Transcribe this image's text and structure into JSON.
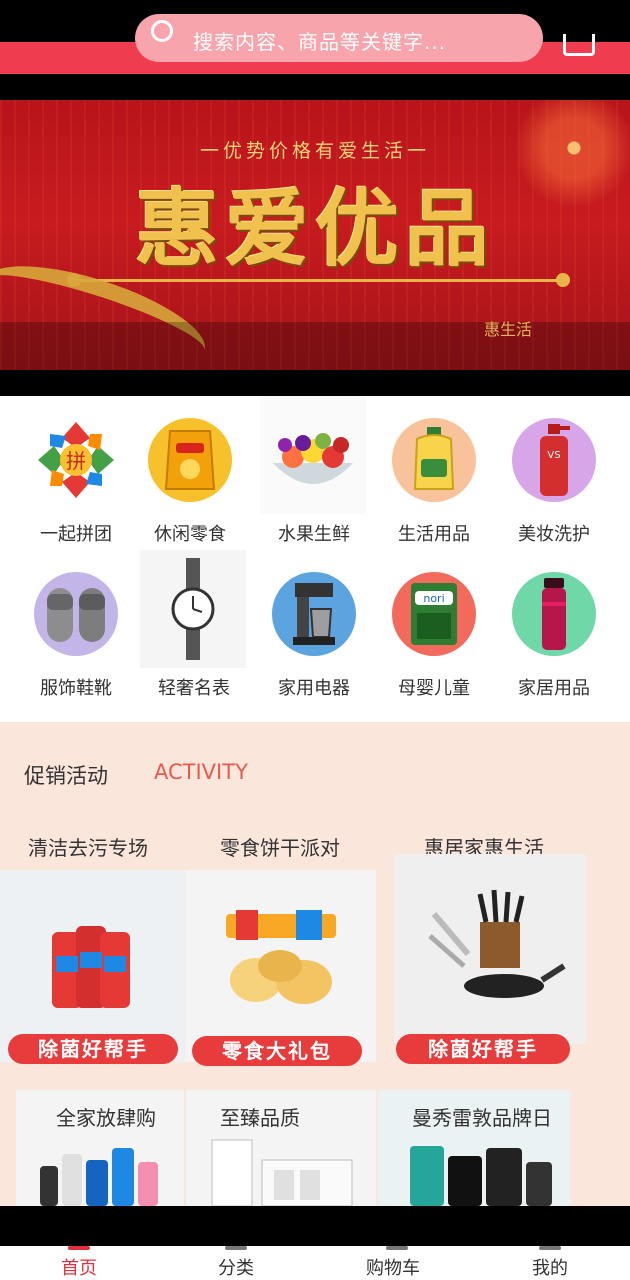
{
  "header": {
    "search_placeholder": "搜索内容、商品等关键字...",
    "accent": "#ef3d4f"
  },
  "banner": {
    "subtitle": "一优势价格有爱生活一",
    "title": "惠爱优品",
    "mark": "惠生活"
  },
  "categories": [
    {
      "label": "一起拼团",
      "icon": "group-buy-icon"
    },
    {
      "label": "休闲零食",
      "icon": "snack-icon"
    },
    {
      "label": "水果生鲜",
      "icon": "fruit-icon"
    },
    {
      "label": "生活用品",
      "icon": "oil-bottle-icon"
    },
    {
      "label": "美妆洗护",
      "icon": "shampoo-icon"
    },
    {
      "label": "服饰鞋靴",
      "icon": "slipper-icon"
    },
    {
      "label": "轻奢名表",
      "icon": "watch-icon"
    },
    {
      "label": "家用电器",
      "icon": "coffee-maker-icon"
    },
    {
      "label": "母婴儿童",
      "icon": "seaweed-snack-icon"
    },
    {
      "label": "家居用品",
      "icon": "thermos-icon"
    }
  ],
  "promo": {
    "title": "促销活动",
    "title_en": "ACTIVITY",
    "cards": [
      {
        "title": "清洁去污专场",
        "tag": "除菌好帮手"
      },
      {
        "title": "零食饼干派对",
        "tag": "零食大礼包"
      },
      {
        "title": "惠居家惠生活",
        "tag": "除菌好帮手"
      }
    ],
    "cards2": [
      {
        "title": "全家放肆购"
      },
      {
        "title": "至臻品质"
      },
      {
        "title": "曼秀雷敦品牌日"
      }
    ]
  },
  "nav": [
    {
      "label": "首页",
      "icon": "home-icon",
      "active": true
    },
    {
      "label": "分类",
      "icon": "category-icon"
    },
    {
      "label": "购物车",
      "icon": "cart-icon"
    },
    {
      "label": "我的",
      "icon": "user-icon"
    }
  ]
}
